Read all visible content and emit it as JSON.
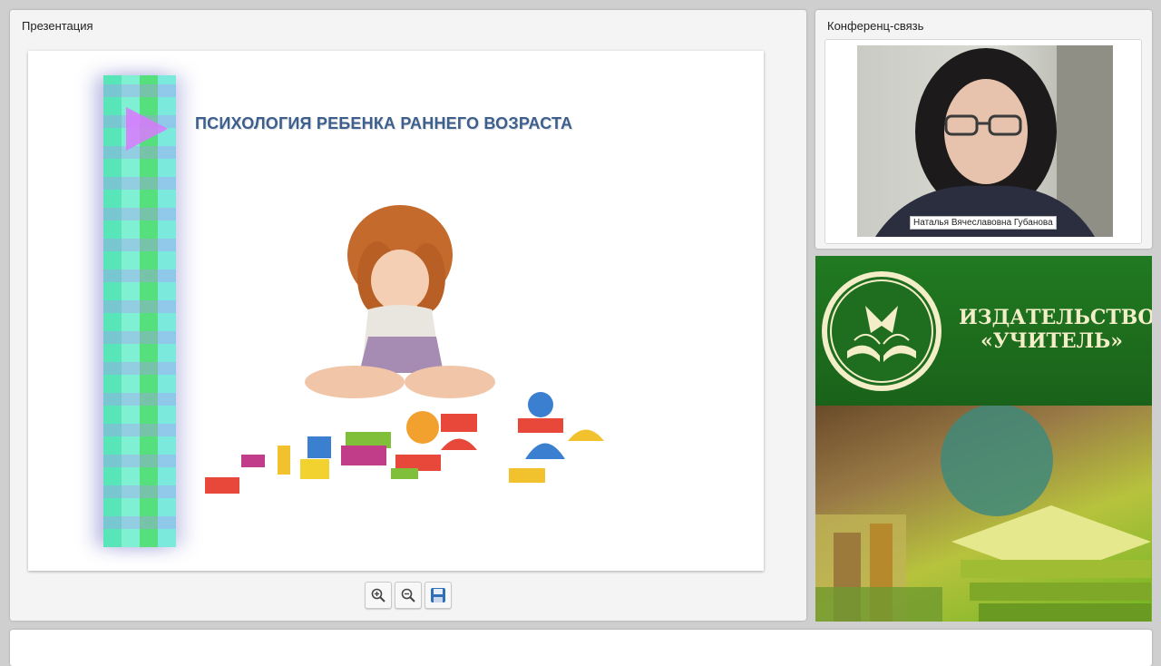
{
  "presentation": {
    "title": "Презентация",
    "slide": {
      "heading": "ПСИХОЛОГИЯ РЕБЕНКА РАННЕГО ВОЗРАСТА"
    },
    "toolbar": {
      "zoom_in_icon": "zoom-in-icon",
      "zoom_out_icon": "zoom-out-icon",
      "save_icon": "save-icon"
    }
  },
  "conference": {
    "title": "Конференц-связь",
    "speaker_name": "Наталья Вячеславовна Губанова"
  },
  "ad": {
    "publisher_line1": "ИЗДАТЕЛЬСТВО",
    "publisher_line2": "«УЧИТЕЛЬ»",
    "brand_color": "#1f6e1f",
    "text_color": "#f3eec8"
  }
}
